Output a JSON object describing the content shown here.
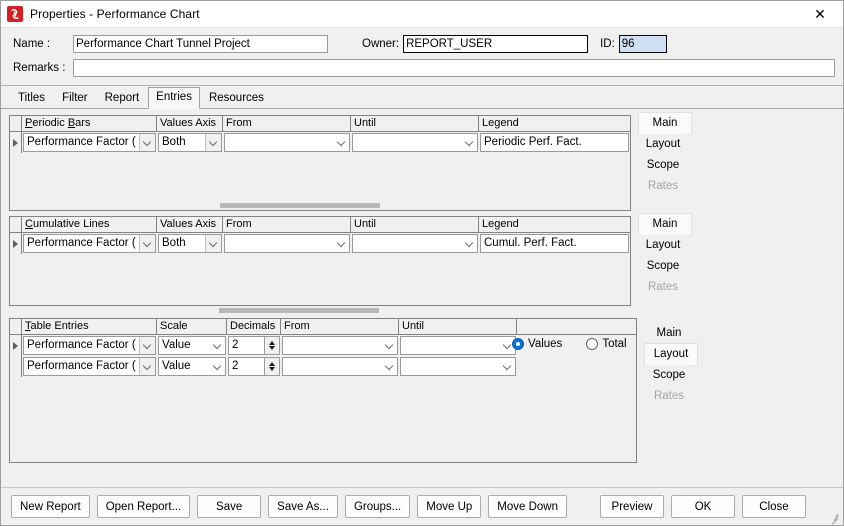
{
  "window": {
    "title": "Properties - Performance Chart",
    "icon": "app-icon",
    "close_label": "✕"
  },
  "header": {
    "name_label": "Name :",
    "name_value": "Performance Chart Tunnel Project",
    "owner_label": "Owner:",
    "owner_value": "REPORT_USER",
    "id_label": "ID:",
    "id_value": "96",
    "remarks_label": "Remarks :",
    "remarks_value": ""
  },
  "tabs": [
    {
      "label": "Titles",
      "active": false
    },
    {
      "label": "Filter",
      "active": false
    },
    {
      "label": "Report",
      "active": false
    },
    {
      "label": "Entries",
      "active": true
    },
    {
      "label": "Resources",
      "active": false
    }
  ],
  "sections": [
    {
      "id": "periodic-bars",
      "headers": [
        "Periodic Bars",
        "Values Axis",
        "From",
        "Until",
        "Legend"
      ],
      "rows": [
        {
          "marker": true,
          "entry": "Performance Factor (",
          "values_axis": "Both",
          "from": "",
          "until": "",
          "legend": "Periodic Perf. Fact."
        }
      ],
      "side_buttons": [
        {
          "label": "Main",
          "state": "raised"
        },
        {
          "label": "Layout",
          "state": "normal"
        },
        {
          "label": "Scope",
          "state": "normal"
        },
        {
          "label": "Rates",
          "state": "disabled"
        }
      ]
    },
    {
      "id": "cumulative-lines",
      "headers": [
        "Cumulative Lines",
        "Values Axis",
        "From",
        "Until",
        "Legend"
      ],
      "rows": [
        {
          "marker": true,
          "entry": "Performance Factor (",
          "values_axis": "Both",
          "from": "",
          "until": "",
          "legend": "Cumul. Perf. Fact."
        }
      ],
      "side_buttons": [
        {
          "label": "Main",
          "state": "raised"
        },
        {
          "label": "Layout",
          "state": "normal"
        },
        {
          "label": "Scope",
          "state": "normal"
        },
        {
          "label": "Rates",
          "state": "disabled"
        }
      ]
    },
    {
      "id": "table-entries",
      "headers": [
        "Table Entries",
        "Scale",
        "Decimals",
        "From",
        "Until"
      ],
      "rows": [
        {
          "marker": true,
          "entry": "Performance Factor (",
          "scale": "Value",
          "decimals": "2",
          "from": "",
          "until": ""
        },
        {
          "marker": false,
          "entry": "Performance Factor (",
          "scale": "Value",
          "decimals": "2",
          "from": "",
          "until": ""
        }
      ],
      "radios": [
        {
          "label": "Values",
          "selected": true
        },
        {
          "label": "Total",
          "selected": false
        }
      ],
      "side_buttons": [
        {
          "label": "Main",
          "state": "normal"
        },
        {
          "label": "Layout",
          "state": "raised"
        },
        {
          "label": "Scope",
          "state": "normal"
        },
        {
          "label": "Rates",
          "state": "disabled"
        }
      ]
    }
  ],
  "footer": {
    "buttons": [
      "New Report",
      "Open Report...",
      "Save",
      "Save As...",
      "Groups...",
      "Move Up",
      "Move Down",
      "Preview",
      "OK",
      "Close"
    ]
  }
}
